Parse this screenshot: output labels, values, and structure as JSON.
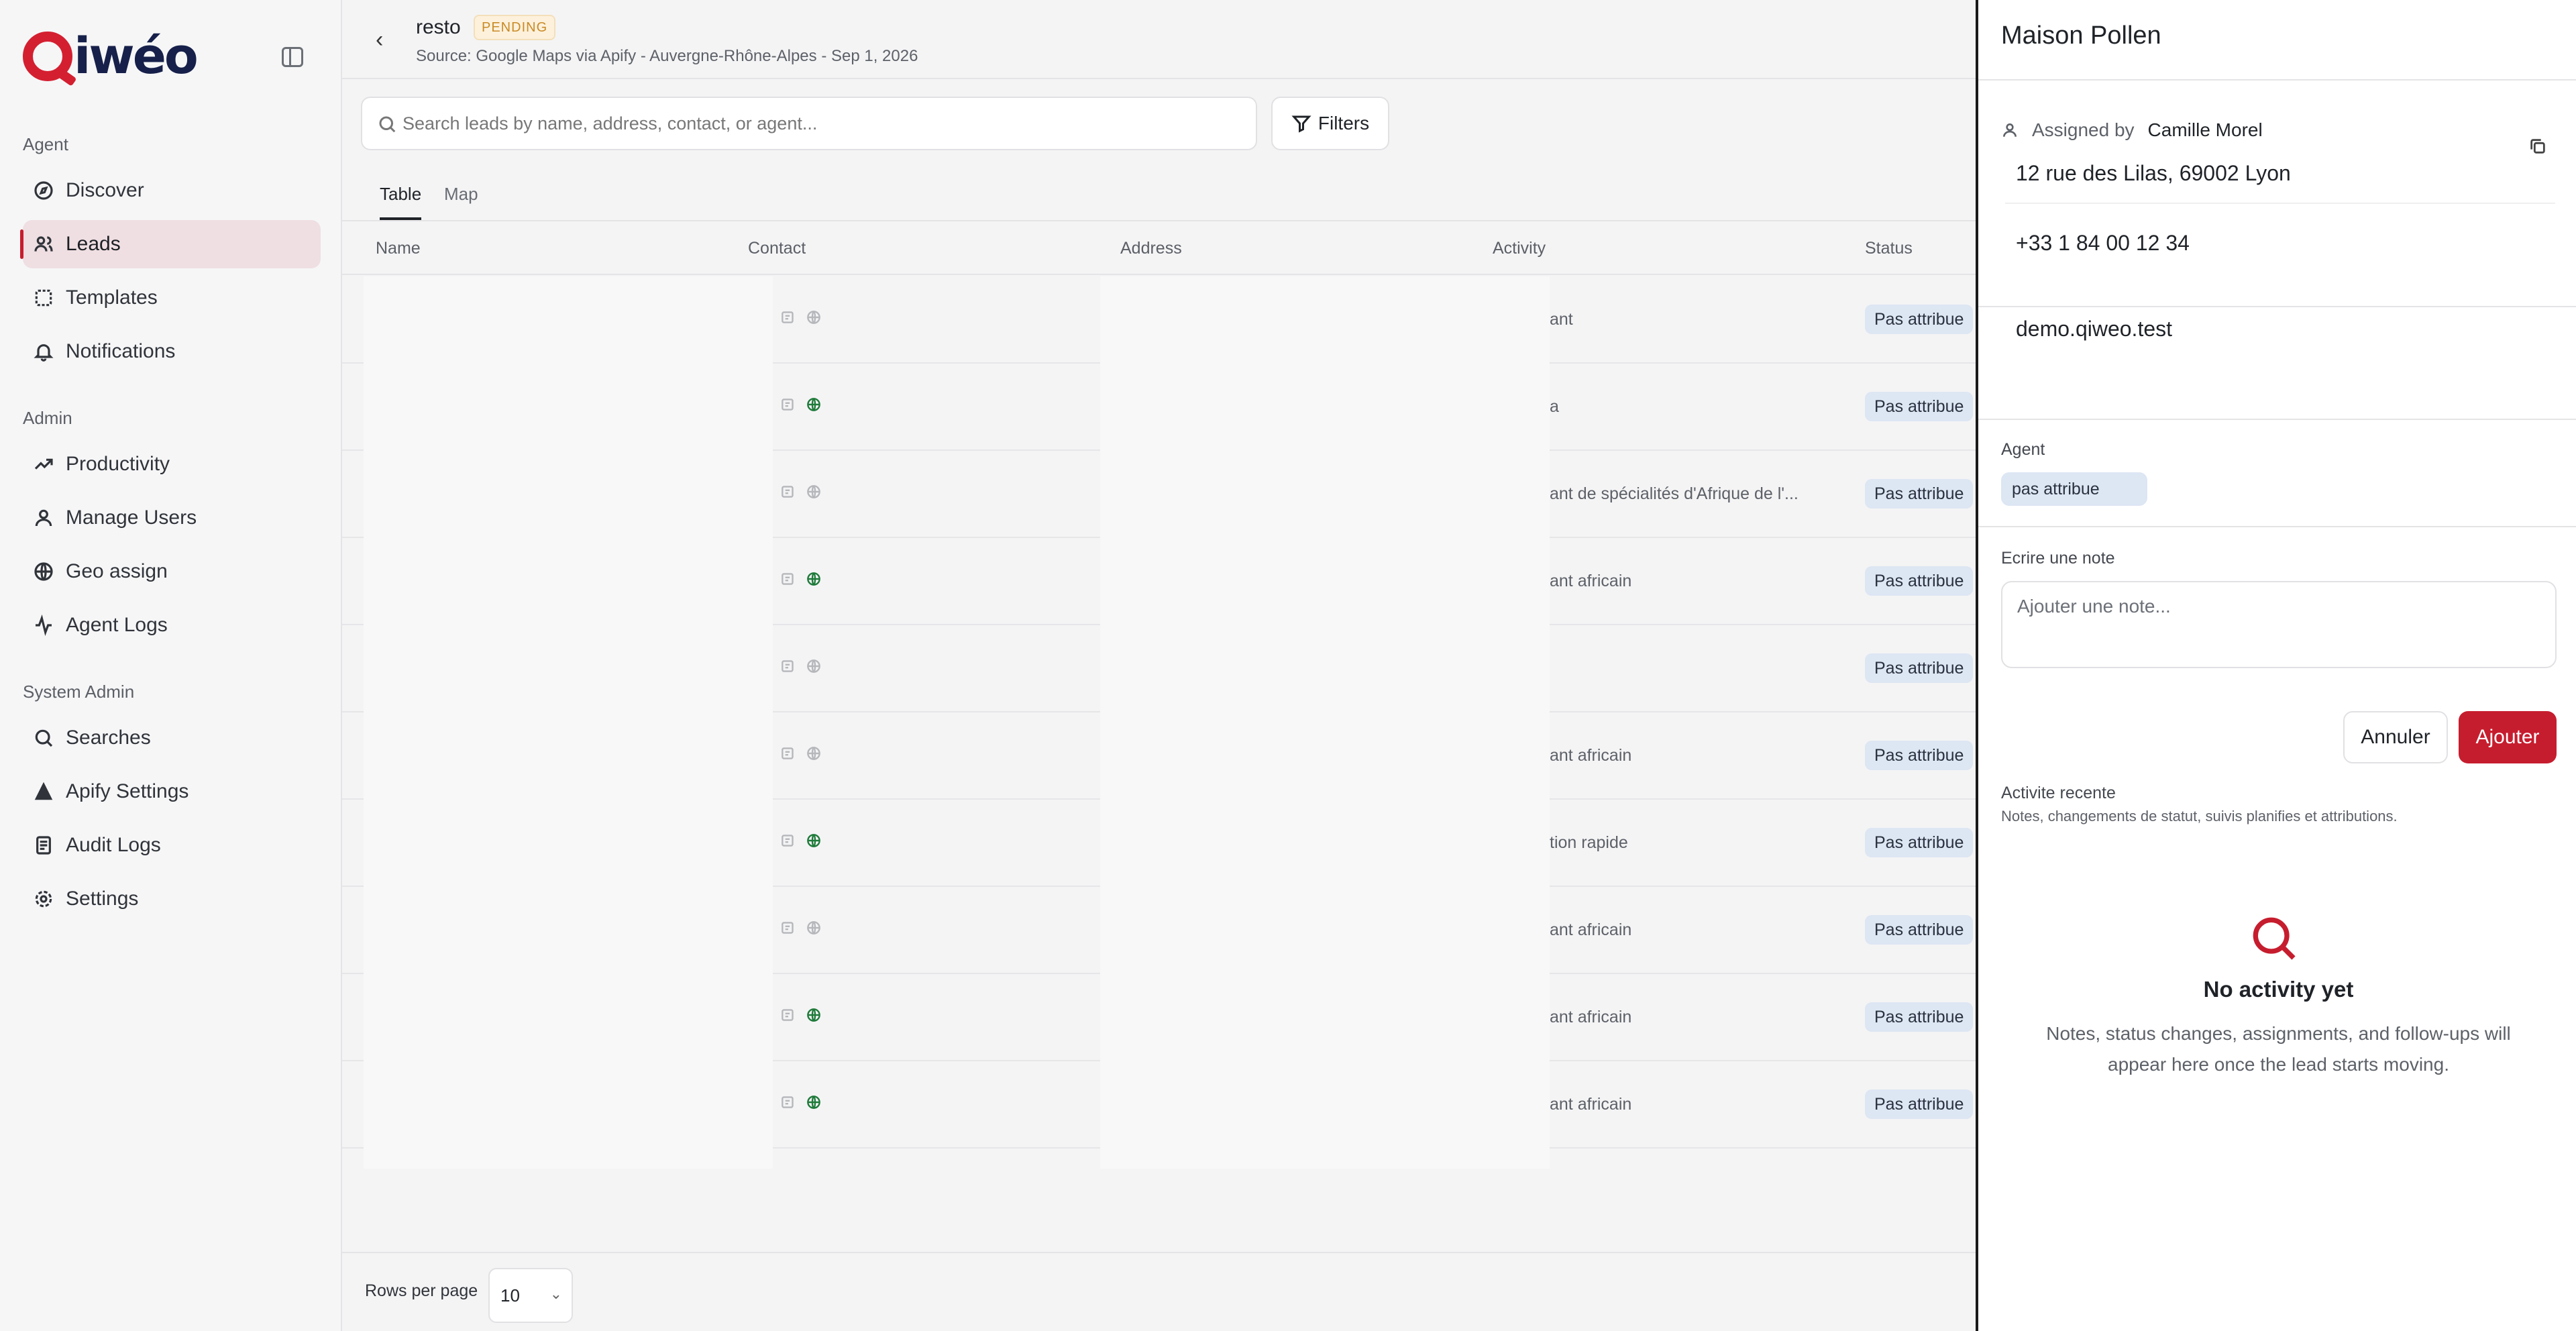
{
  "app": {
    "logo_text": "iwéo",
    "brand_color": "#d41f30"
  },
  "sidebar": {
    "sections": [
      {
        "title": "Agent",
        "items": [
          {
            "label": "Discover",
            "icon": "compass-icon"
          },
          {
            "label": "Leads",
            "icon": "users-icon",
            "active": true
          },
          {
            "label": "Templates",
            "icon": "template-icon"
          },
          {
            "label": "Notifications",
            "icon": "bell-icon"
          }
        ]
      },
      {
        "title": "Admin",
        "items": [
          {
            "label": "Productivity",
            "icon": "trending-up-icon"
          },
          {
            "label": "Manage Users",
            "icon": "user-icon"
          },
          {
            "label": "Geo assign",
            "icon": "globe-icon"
          },
          {
            "label": "Agent Logs",
            "icon": "activity-icon"
          }
        ]
      },
      {
        "title": "System Admin",
        "items": [
          {
            "label": "Searches",
            "icon": "search-icon"
          },
          {
            "label": "Apify Settings",
            "icon": "apify-icon"
          },
          {
            "label": "Audit Logs",
            "icon": "log-icon"
          },
          {
            "label": "Settings",
            "icon": "gear-icon"
          }
        ]
      }
    ]
  },
  "header": {
    "title": "resto",
    "badge": "PENDING",
    "source": "Source: Google Maps via Apify - Auvergne-Rhône-Alpes - Sep 1, 2026"
  },
  "search": {
    "placeholder": "Search leads by name, address, contact, or agent..."
  },
  "filters_label": "Filters",
  "tabs": [
    "Table",
    "Map"
  ],
  "table": {
    "columns": [
      "Name",
      "Contact",
      "Address",
      "Activity",
      "Status"
    ],
    "rows": [
      {
        "activity": "ant",
        "status": "Pas attribue",
        "web": false
      },
      {
        "activity": "a",
        "status": "Pas attribue",
        "web": true
      },
      {
        "activity": "ant de spécialités d'Afrique de l'...",
        "status": "Pas attribue",
        "web": false
      },
      {
        "activity": "ant africain",
        "status": "Pas attribue",
        "web": true
      },
      {
        "activity": "",
        "status": "Pas attribue",
        "web": false
      },
      {
        "activity": "ant africain",
        "status": "Pas attribue",
        "web": false
      },
      {
        "activity": "tion rapide",
        "status": "Pas attribue",
        "web": true
      },
      {
        "activity": "ant africain",
        "status": "Pas attribue",
        "web": false
      },
      {
        "activity": "ant africain",
        "status": "Pas attribue",
        "web": true
      },
      {
        "activity": "ant africain",
        "status": "Pas attribue",
        "web": true
      }
    ]
  },
  "pagination": {
    "rows_label": "Rows per page",
    "rows_value": "10"
  },
  "panel": {
    "title": "Maison Pollen",
    "assigned_by_label": "Assigned by",
    "assigned_by": "Camille Morel",
    "address": "12 rue des Lilas, 69002 Lyon",
    "phone": "+33 1 84 00 12 34",
    "website": "demo.qiweo.test",
    "agent_label": "Agent",
    "agent_value": "pas attribue",
    "note_label": "Ecrire une note",
    "note_placeholder": "Ajouter une note...",
    "cancel_label": "Annuler",
    "add_label": "Ajouter",
    "recent_title": "Activite recente",
    "recent_sub": "Notes, changements de statut, suivis planifies et attributions.",
    "empty_title": "No activity yet",
    "empty_desc": "Notes, status changes, assignments, and follow-ups will appear here once the lead starts moving."
  }
}
